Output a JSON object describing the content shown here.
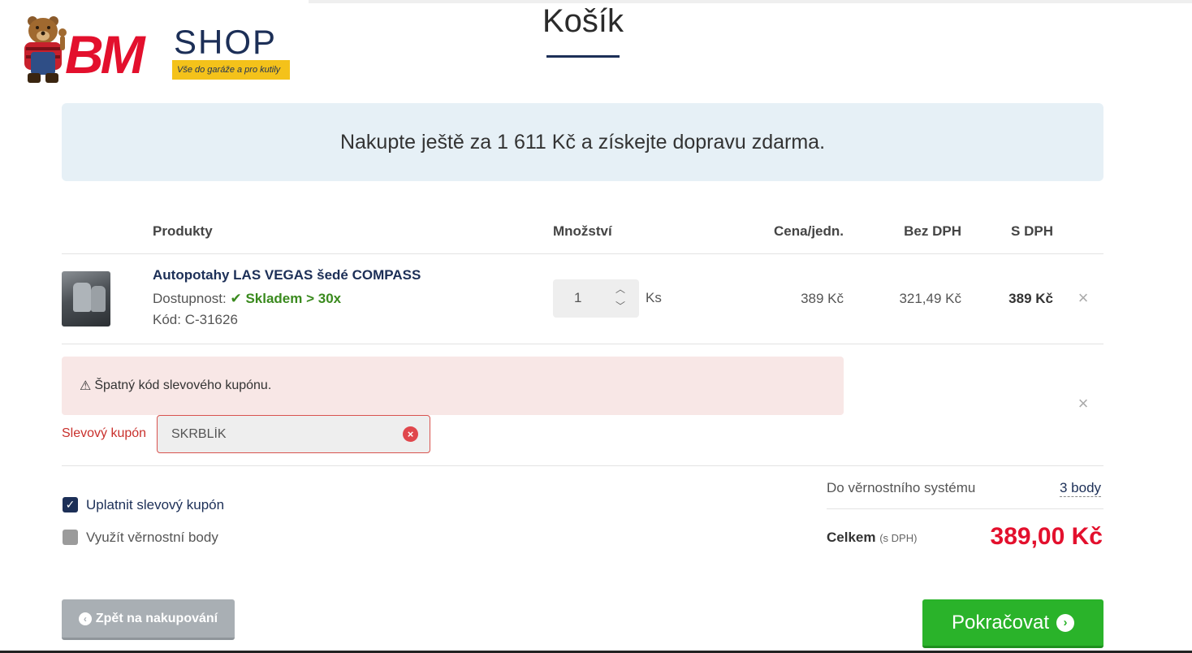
{
  "logo": {
    "brand": "BM",
    "shop": "SHOP",
    "tagline": "Vše do garáže a pro kutily"
  },
  "page": {
    "title": "Košík"
  },
  "banner": {
    "text": "Nakupte ještě za 1 611 Kč a získejte dopravu zdarma."
  },
  "table": {
    "headers": {
      "products": "Produkty",
      "quantity": "Množství",
      "unit_price": "Cena/jedn.",
      "without_vat": "Bez DPH",
      "with_vat": "S DPH"
    },
    "items": [
      {
        "name": "Autopotahy LAS VEGAS šedé COMPASS",
        "availability_label": "Dostupnost:",
        "availability_value": "Skladem > 30x",
        "code": "Kód: C-31626",
        "quantity": "1",
        "unit": "Ks",
        "unit_price": "389 Kč",
        "without_vat": "321,49 Kč",
        "with_vat": "389 Kč"
      }
    ]
  },
  "coupon": {
    "error": "Špatný kód slevového kupónu.",
    "label": "Slevový kupón",
    "value": "SKRBLÍK"
  },
  "options": {
    "apply_coupon": {
      "label": "Uplatnit slevový kupón",
      "checked": true
    },
    "use_points": {
      "label": "Využít věrnostní body",
      "checked": false
    }
  },
  "summary": {
    "loyalty_label": "Do věrnostního systému",
    "loyalty_points": "3 body",
    "total_label": "Celkem",
    "total_suffix": "(s DPH)",
    "total_value": "389,00 Kč"
  },
  "buttons": {
    "back": "Zpět na nakupování",
    "continue": "Pokračovat"
  },
  "colors": {
    "brand_red": "#e3102d",
    "brand_navy": "#1c2f57",
    "accent_yellow": "#f4c21a",
    "success_green": "#2ab32a",
    "error_red": "#d9534f"
  }
}
